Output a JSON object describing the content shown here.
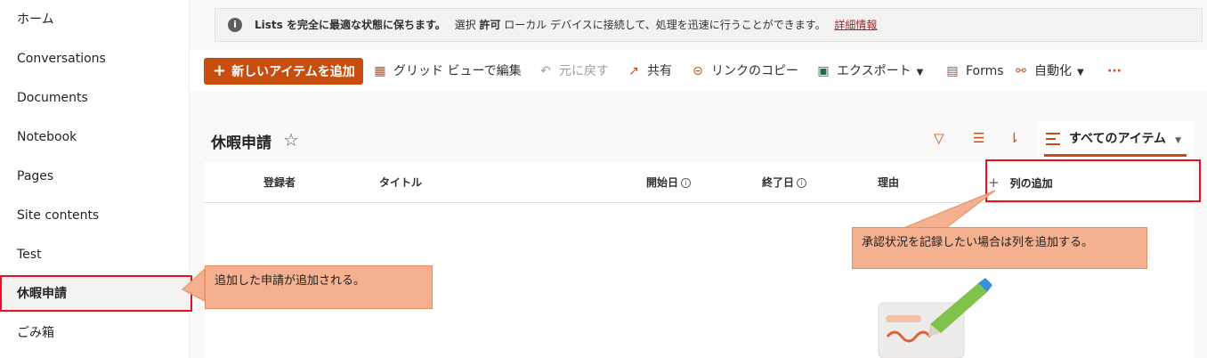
{
  "sidebar": {
    "items": [
      {
        "label": "ホーム"
      },
      {
        "label": "Conversations"
      },
      {
        "label": "Documents"
      },
      {
        "label": "Notebook"
      },
      {
        "label": "Pages"
      },
      {
        "label": "Site contents"
      },
      {
        "label": "Test"
      },
      {
        "label": "休暇申請",
        "active": true
      },
      {
        "label": "ごみ箱"
      }
    ]
  },
  "infobar": {
    "icon": "info-icon",
    "part1": "Lists を完全に最適な状態に保ちます。",
    "part2": "選択",
    "part3": "許可",
    "part4": "ローカル デバイスに接続して、処理を迅速に行うことができます。",
    "link": "詳細情報"
  },
  "commandbar": {
    "new_item": "新しいアイテムを追加",
    "grid_edit": "グリッド ビューで編集",
    "undo": "元に戻す",
    "share": "共有",
    "copy_link": "リンクのコピー",
    "export": "エクスポート",
    "forms": "Forms",
    "automate": "自動化",
    "more": "···"
  },
  "list": {
    "title": "休暇申請",
    "view_name": "すべてのアイテム"
  },
  "columns": {
    "created_by": "登録者",
    "title": "タイトル",
    "start_date": "開始日",
    "end_date": "終了日",
    "reason": "理由",
    "add_column": "列の追加"
  },
  "annotations": {
    "sidebar_note": "追加した申請が追加される。",
    "column_note": "承認状況を記録したい場合は列を追加する。"
  },
  "colors": {
    "accent": "#c84e0f",
    "highlight_box": "#e81123",
    "callout_fill": "#f4b08f"
  }
}
